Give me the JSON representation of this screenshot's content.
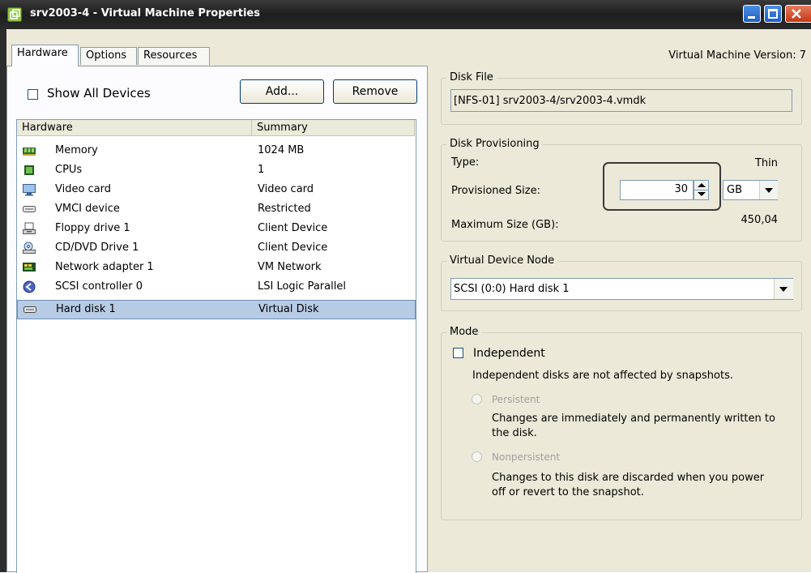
{
  "window": {
    "title": "srv2003-4 - Virtual Machine Properties",
    "controls": {
      "minimize": "_",
      "maximize": "□",
      "close": "✕"
    }
  },
  "tabs": [
    {
      "label": "Hardware",
      "active": true
    },
    {
      "label": "Options",
      "active": false
    },
    {
      "label": "Resources",
      "active": false
    }
  ],
  "version_label": "Virtual Machine Version: 7",
  "left": {
    "show_all_devices": {
      "label": "Show All Devices",
      "checked": false
    },
    "add_button": "Add...",
    "remove_button": "Remove",
    "columns": {
      "hardware": "Hardware",
      "summary": "Summary"
    },
    "devices": [
      {
        "name": "Memory",
        "summary": "1024 MB",
        "icon": "memory-icon"
      },
      {
        "name": "CPUs",
        "summary": "1",
        "icon": "cpu-icon"
      },
      {
        "name": "Video card",
        "summary": "Video card",
        "icon": "monitor-icon"
      },
      {
        "name": "VMCI device",
        "summary": "Restricted",
        "icon": "vmci-icon"
      },
      {
        "name": "Floppy drive 1",
        "summary": "Client Device",
        "icon": "floppy-icon"
      },
      {
        "name": "CD/DVD Drive 1",
        "summary": "Client Device",
        "icon": "cd-drive-icon"
      },
      {
        "name": "Network adapter 1",
        "summary": "VM Network",
        "icon": "network-adapter-icon"
      },
      {
        "name": "SCSI controller 0",
        "summary": "LSI Logic Parallel",
        "icon": "scsi-controller-icon"
      },
      {
        "name": "Hard disk 1",
        "summary": "Virtual Disk",
        "icon": "hard-disk-icon",
        "selected": true
      }
    ]
  },
  "disk_file": {
    "legend": "Disk File",
    "value": "[NFS-01] srv2003-4/srv2003-4.vmdk"
  },
  "disk_provisioning": {
    "legend": "Disk Provisioning",
    "type_label": "Type:",
    "type_value": "Thin",
    "size_label": "Provisioned Size:",
    "size_value": "30",
    "unit_value": "GB",
    "max_label": "Maximum Size (GB):",
    "max_value": "450,04"
  },
  "device_node": {
    "legend": "Virtual Device Node",
    "value": "SCSI (0:0) Hard disk 1"
  },
  "mode": {
    "legend": "Mode",
    "independent_label": "Independent",
    "independent_checked": false,
    "independent_desc": "Independent disks are not affected by snapshots.",
    "persistent_label": "Persistent",
    "persistent_desc_1": "Changes are immediately and permanently written to",
    "persistent_desc_2": "the disk.",
    "nonpersistent_label": "Nonpersistent",
    "nonpersistent_desc_1": "Changes to this disk are discarded when you power",
    "nonpersistent_desc_2": "off or revert to the snapshot."
  },
  "colors": {
    "titlebar": "#2a2a2a",
    "selection": "#b8cbe5",
    "window_bg": "#ece9d8",
    "close_button": "#c43814"
  }
}
